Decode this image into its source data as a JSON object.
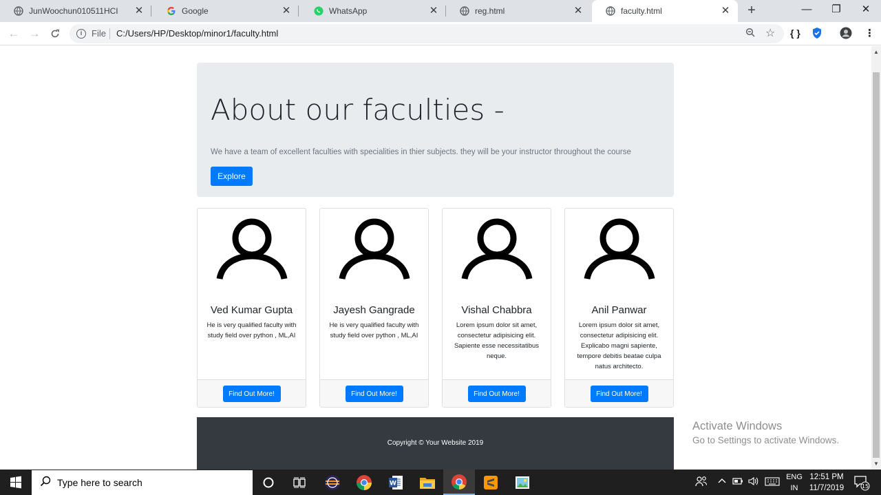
{
  "browser": {
    "tabs": [
      {
        "title": "JunWoochun010511HCI",
        "icon": "globe-icon"
      },
      {
        "title": "Google",
        "icon": "google-icon"
      },
      {
        "title": "WhatsApp",
        "icon": "whatsapp-icon"
      },
      {
        "title": "reg.html",
        "icon": "globe-icon"
      },
      {
        "title": "faculty.html",
        "icon": "globe-icon",
        "active": true
      }
    ],
    "new_tab": "+",
    "window_controls": {
      "minimize": "—",
      "restore": "❐",
      "close": "✕"
    },
    "address": {
      "scheme": "File",
      "url": "C:/Users/HP/Desktop/minor1/faculty.html"
    },
    "extensions": {
      "braces": "{ }"
    }
  },
  "page": {
    "jumbotron": {
      "heading": "About our faculties -",
      "lead": "We have a team of excellent faculties with specialities in thier subjects. they will be your instructor throughout the course",
      "button": "Explore"
    },
    "cards": [
      {
        "name": "Ved Kumar Gupta",
        "description": "He is very qualified faculty with study field over python , ML,AI",
        "button": "Find Out More!"
      },
      {
        "name": "Jayesh Gangrade",
        "description": "He is very qualified faculty with study field over python , ML,AI",
        "button": "Find Out More!"
      },
      {
        "name": "Vishal Chabbra",
        "description": "Lorem ipsum dolor sit amet, consectetur adipisicing elit. Sapiente esse necessitatibus neque.",
        "button": "Find Out More!"
      },
      {
        "name": "Anil Panwar",
        "description": "Lorem ipsum dolor sit amet, consectetur adipisicing elit. Explicabo magni sapiente, tempore debitis beatae culpa natus architecto.",
        "button": "Find Out More!"
      }
    ],
    "footer": "Copyright © Your Website 2019"
  },
  "watermark": {
    "line1": "Activate Windows",
    "line2": "Go to Settings to activate Windows."
  },
  "taskbar": {
    "search_placeholder": "Type here to search",
    "language": {
      "line1": "ENG",
      "line2": "IN"
    },
    "clock": {
      "time": "12:51 PM",
      "date": "11/7/2019"
    },
    "notifications": "15"
  },
  "colors": {
    "primary": "#007bff",
    "jumbotron_bg": "#e9ecef",
    "footer_bg": "#343a40",
    "taskbar_bg": "#1f1f1f"
  }
}
